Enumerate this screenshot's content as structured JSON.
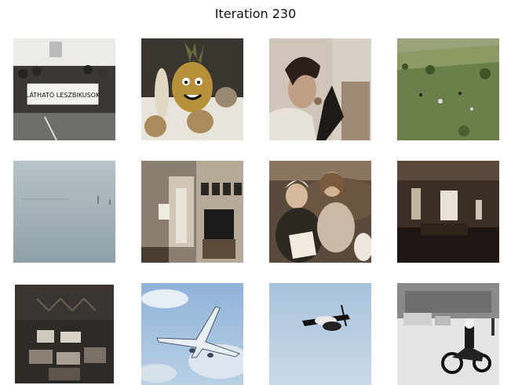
{
  "title": "Iteration 230",
  "images": [
    {
      "name": "protest-crowd-banner",
      "banner_text": "LÁTHATÓ LESZBIKUSOK"
    },
    {
      "name": "fruit-faces-pineapple"
    },
    {
      "name": "woman-eating-with-bag"
    },
    {
      "name": "green-field-pasture"
    },
    {
      "name": "foggy-water-seascape"
    },
    {
      "name": "hallway-living-room"
    },
    {
      "name": "women-reading-on-couch"
    },
    {
      "name": "dark-interior-room"
    },
    {
      "name": "tiled-room-interior"
    },
    {
      "name": "jet-airplane-sky"
    },
    {
      "name": "snowboarder-midair"
    },
    {
      "name": "police-motorcycle-street"
    }
  ]
}
